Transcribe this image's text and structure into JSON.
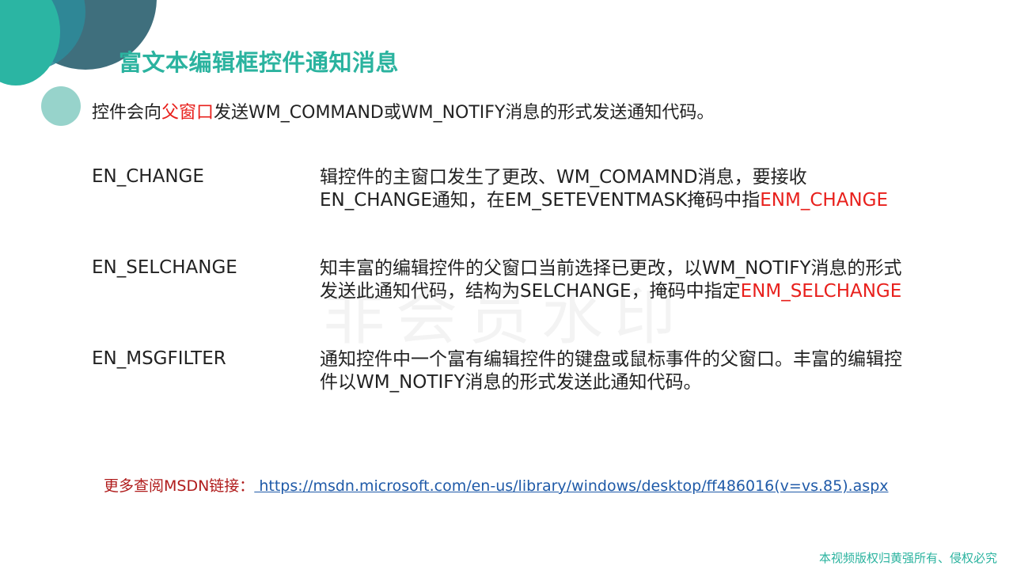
{
  "title": "富文本编辑框控件通知消息",
  "intro": {
    "part1": "控件会向",
    "highlight": "父窗口",
    "part2": "发送WM_COMMAND或WM_NOTIFY消息的形式发送通知代码。"
  },
  "watermark": "非会员水印",
  "items": [
    {
      "term": "EN_CHANGE",
      "line1": "辑控件的主窗口发生了更改、WM_COMAMND消息，要接收",
      "line2": "EN_CHANGE通知，在EM_SETEVENTMASK掩码中指",
      "line2_red": "ENM_CHANGE"
    },
    {
      "term": "EN_SELCHANGE",
      "line1": "知丰富的编辑控件的父窗口当前选择已更改，以WM_NOTIFY消息的形式",
      "line2": "发送此通知代码，结构为SELCHANGE，掩码中指定",
      "line2_red": "ENM_SELCHANGE"
    },
    {
      "term": "EN_MSGFILTER",
      "line1": "通知控件中一个富有编辑控件的键盘或鼠标事件的父窗口。丰富的编辑控",
      "line2": "件以WM_NOTIFY消息的形式发送此通知代码。",
      "line2_red": ""
    }
  ],
  "msdn": {
    "label": "更多查阅MSDN链接：",
    "url": " https://msdn.microsoft.com/en-us/library/windows/desktop/ff486016(v=vs.85).aspx"
  },
  "copyright": "本视频版权归黄强所有、侵权必究",
  "colors": {
    "accent": "#2bb39f",
    "highlight_red": "#e8201c",
    "link": "#1f5aa8"
  }
}
